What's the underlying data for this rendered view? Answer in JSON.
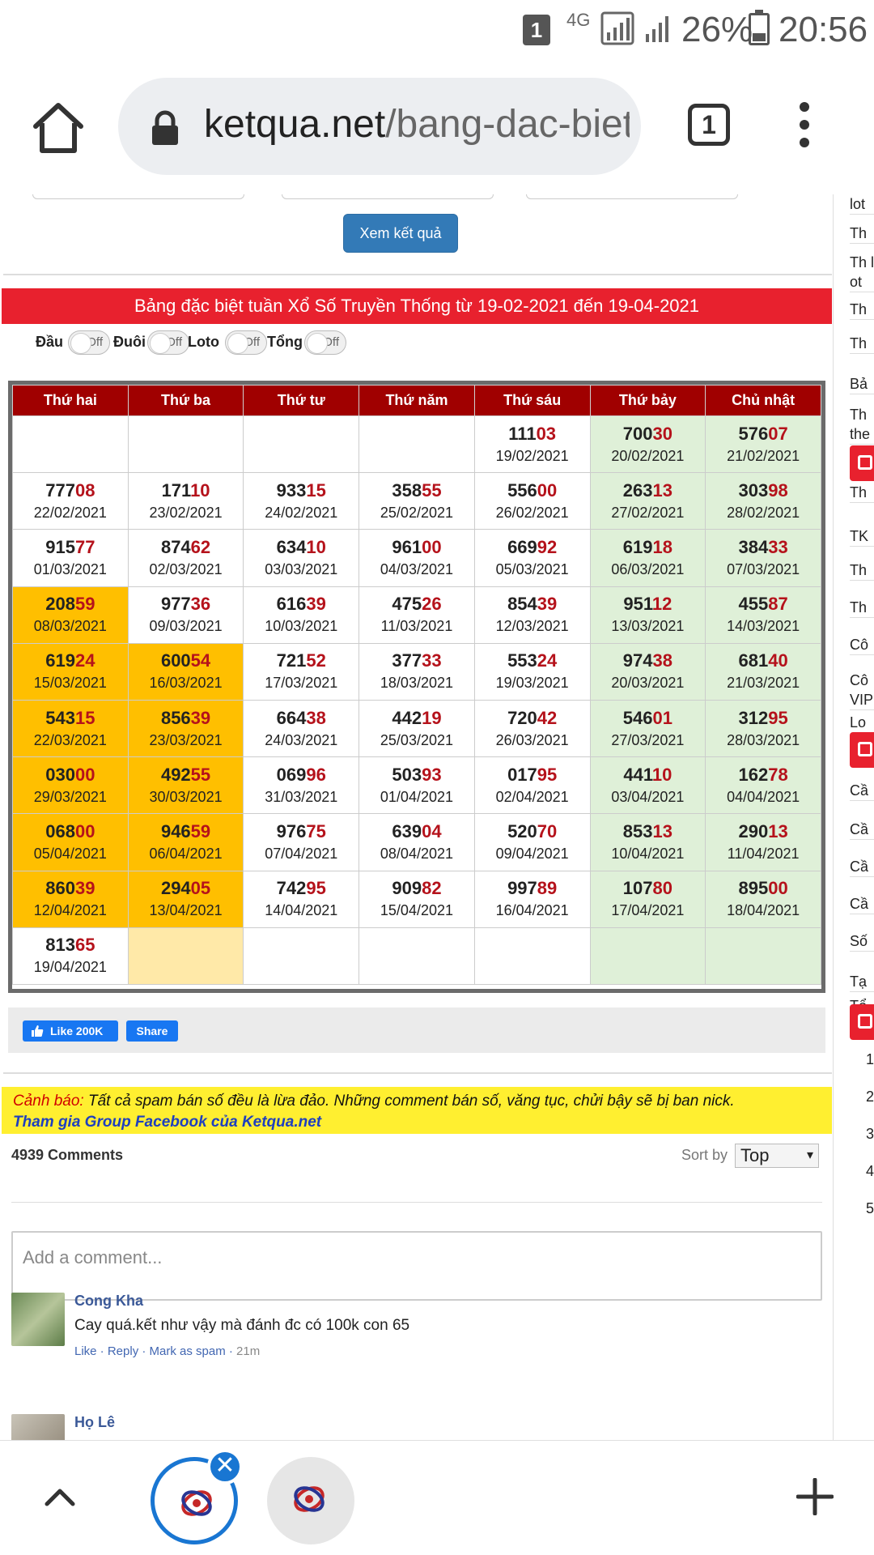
{
  "status_bar": {
    "sim": "1",
    "network": "4G",
    "battery": "26%",
    "time": "20:56"
  },
  "browser": {
    "url_domain": "ketqua.net",
    "url_path": "/bang-dac-biet",
    "tab_count": "1"
  },
  "form": {
    "submit_label": "Xem kết quả"
  },
  "table_title": "Bảng đặc biệt tuần Xổ Số Truyền Thống từ 19-02-2021 đến 19-04-2021",
  "toggles": [
    {
      "label": "Đầu",
      "state": "Off"
    },
    {
      "label": "Đuôi",
      "state": "Off"
    },
    {
      "label": "Loto",
      "state": "Off"
    },
    {
      "label": "Tổng",
      "state": "Off"
    }
  ],
  "grid": {
    "headers": [
      "Thứ hai",
      "Thứ ba",
      "Thứ tư",
      "Thứ năm",
      "Thứ sáu",
      "Thứ bảy",
      "Chủ nhật"
    ],
    "rows": [
      [
        {},
        {},
        {},
        {},
        {
          "num": "11103",
          "date": "19/02/2021"
        },
        {
          "num": "70030",
          "date": "20/02/2021"
        },
        {
          "num": "57607",
          "date": "21/02/2021"
        }
      ],
      [
        {
          "num": "77708",
          "date": "22/02/2021"
        },
        {
          "num": "17110",
          "date": "23/02/2021"
        },
        {
          "num": "93315",
          "date": "24/02/2021"
        },
        {
          "num": "35855",
          "date": "25/02/2021"
        },
        {
          "num": "55600",
          "date": "26/02/2021"
        },
        {
          "num": "26313",
          "date": "27/02/2021"
        },
        {
          "num": "30398",
          "date": "28/02/2021"
        }
      ],
      [
        {
          "num": "91577",
          "date": "01/03/2021"
        },
        {
          "num": "87462",
          "date": "02/03/2021"
        },
        {
          "num": "63410",
          "date": "03/03/2021"
        },
        {
          "num": "96100",
          "date": "04/03/2021"
        },
        {
          "num": "66992",
          "date": "05/03/2021"
        },
        {
          "num": "61918",
          "date": "06/03/2021"
        },
        {
          "num": "38433",
          "date": "07/03/2021"
        }
      ],
      [
        {
          "num": "20859",
          "date": "08/03/2021",
          "hl": true
        },
        {
          "num": "97736",
          "date": "09/03/2021"
        },
        {
          "num": "61639",
          "date": "10/03/2021"
        },
        {
          "num": "47526",
          "date": "11/03/2021"
        },
        {
          "num": "85439",
          "date": "12/03/2021"
        },
        {
          "num": "95112",
          "date": "13/03/2021"
        },
        {
          "num": "45587",
          "date": "14/03/2021"
        }
      ],
      [
        {
          "num": "61924",
          "date": "15/03/2021",
          "hl": true
        },
        {
          "num": "60054",
          "date": "16/03/2021",
          "hl": true
        },
        {
          "num": "72152",
          "date": "17/03/2021"
        },
        {
          "num": "37733",
          "date": "18/03/2021"
        },
        {
          "num": "55324",
          "date": "19/03/2021"
        },
        {
          "num": "97438",
          "date": "20/03/2021"
        },
        {
          "num": "68140",
          "date": "21/03/2021"
        }
      ],
      [
        {
          "num": "54315",
          "date": "22/03/2021",
          "hl": true
        },
        {
          "num": "85639",
          "date": "23/03/2021",
          "hl": true
        },
        {
          "num": "66438",
          "date": "24/03/2021"
        },
        {
          "num": "44219",
          "date": "25/03/2021"
        },
        {
          "num": "72042",
          "date": "26/03/2021"
        },
        {
          "num": "54601",
          "date": "27/03/2021"
        },
        {
          "num": "31295",
          "date": "28/03/2021"
        }
      ],
      [
        {
          "num": "03000",
          "date": "29/03/2021",
          "hl": true
        },
        {
          "num": "49255",
          "date": "30/03/2021",
          "hl": true
        },
        {
          "num": "06996",
          "date": "31/03/2021"
        },
        {
          "num": "50393",
          "date": "01/04/2021"
        },
        {
          "num": "01795",
          "date": "02/04/2021"
        },
        {
          "num": "44110",
          "date": "03/04/2021"
        },
        {
          "num": "16278",
          "date": "04/04/2021"
        }
      ],
      [
        {
          "num": "06800",
          "date": "05/04/2021",
          "hl": true
        },
        {
          "num": "94659",
          "date": "06/04/2021",
          "hl": true
        },
        {
          "num": "97675",
          "date": "07/04/2021"
        },
        {
          "num": "63904",
          "date": "08/04/2021"
        },
        {
          "num": "52070",
          "date": "09/04/2021"
        },
        {
          "num": "85313",
          "date": "10/04/2021"
        },
        {
          "num": "29013",
          "date": "11/04/2021"
        }
      ],
      [
        {
          "num": "86039",
          "date": "12/04/2021",
          "hl": true
        },
        {
          "num": "29405",
          "date": "13/04/2021",
          "hl": true
        },
        {
          "num": "74295",
          "date": "14/04/2021"
        },
        {
          "num": "90982",
          "date": "15/04/2021"
        },
        {
          "num": "99789",
          "date": "16/04/2021"
        },
        {
          "num": "10780",
          "date": "17/04/2021"
        },
        {
          "num": "89500",
          "date": "18/04/2021"
        }
      ],
      [
        {
          "num": "81365",
          "date": "19/04/2021"
        },
        {
          "pale": true
        },
        {},
        {},
        {},
        {},
        {}
      ]
    ]
  },
  "share": {
    "like_label": "Like 200K",
    "share_label": "Share"
  },
  "warning": {
    "label": "Cảnh báo:",
    "text": " Tất cả spam bán số đều là lừa đảo. Những comment bán số, văng tục, chửi bậy sẽ bị ban nick.",
    "link": "Tham gia Group Facebook của Ketqua.net"
  },
  "comments": {
    "count": "4939 Comments",
    "sort_label": "Sort by",
    "sort_value": "Top",
    "placeholder": "Add a comment...",
    "items": [
      {
        "name": "Cong Kha",
        "text": "Cay quá.kết như vậy mà đánh đc có 100k con 65",
        "actions": "Like · Reply · Mark as spam · ",
        "time": "21m"
      },
      {
        "name": "Họ Lê"
      }
    ]
  },
  "sidebar": {
    "items": [
      "lot",
      "Th",
      "Th lot",
      "Th",
      "Th",
      "Bả",
      "Th the",
      "Th",
      "TK",
      "Th",
      "Th",
      "Cô",
      "Cô VIP",
      "Loa",
      "Cầ",
      "Cầ",
      "Cầ",
      "Cầ",
      "Số",
      "Tạ",
      "Tổ"
    ],
    "numbers": [
      "1",
      "2",
      "3",
      "4",
      "5"
    ]
  }
}
